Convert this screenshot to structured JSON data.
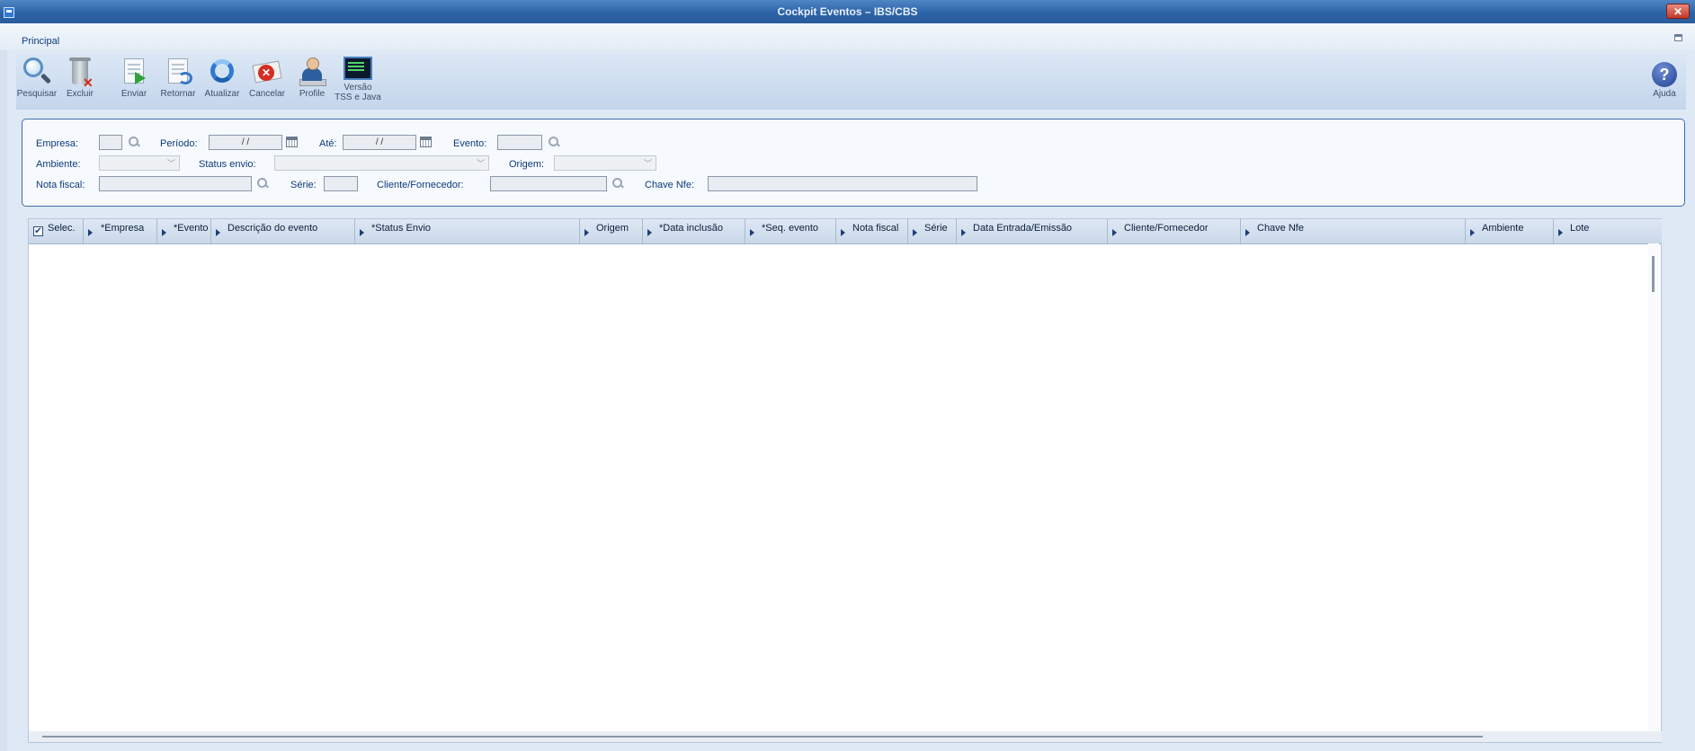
{
  "window": {
    "title": "Cockpit Eventos – IBS/CBS",
    "close_glyph": "✕"
  },
  "tabs": [
    {
      "label": "Principal"
    }
  ],
  "toolbar": {
    "buttons": [
      {
        "label": "Pesquisar",
        "icon": "search-icon"
      },
      {
        "label": "Excluir",
        "icon": "trash-icon"
      },
      {
        "label": "Enviar",
        "icon": "send-document-icon"
      },
      {
        "label": "Retornar",
        "icon": "return-document-icon"
      },
      {
        "label": "Atualizar",
        "icon": "refresh-icon"
      },
      {
        "label": "Cancelar",
        "icon": "cancel-icon"
      },
      {
        "label": "Profile",
        "icon": "profile-icon"
      },
      {
        "label_line1": "Versão",
        "label_line2": "TSS e Java",
        "icon": "terminal-icon"
      }
    ],
    "help": {
      "label": "Ajuda",
      "glyph": "?",
      "icon": "help-icon"
    }
  },
  "filters": {
    "empresa": {
      "label": "Empresa:",
      "value": ""
    },
    "periodo": {
      "label": "Período:",
      "value": " / /"
    },
    "ate": {
      "label": "Até:",
      "value": " / /"
    },
    "evento": {
      "label": "Evento:",
      "value": ""
    },
    "ambiente": {
      "label": "Ambiente:",
      "value": ""
    },
    "status_envio": {
      "label": "Status envio:",
      "value": ""
    },
    "origem": {
      "label": "Origem:",
      "value": ""
    },
    "nota_fiscal": {
      "label": "Nota fiscal:",
      "value": ""
    },
    "serie": {
      "label": "Série:",
      "value": ""
    },
    "cliente_fornecedor": {
      "label": "Cliente/Fornecedor:",
      "value": ""
    },
    "chave_nfe": {
      "label": "Chave Nfe:",
      "value": ""
    }
  },
  "grid": {
    "select_all_checked": true,
    "columns": [
      "Selec.",
      "*Empresa",
      "*Evento",
      "Descrição do evento",
      "*Status Envio",
      "Origem",
      "*Data inclusão",
      "*Seq. evento",
      "Nota fiscal",
      "Série",
      "Data Entrada/Emissão",
      "Cliente/Fornecedor",
      "Chave Nfe",
      "Ambiente",
      "Lote"
    ],
    "rows": []
  },
  "colors": {
    "titlebar": "#2d63a7",
    "panel_border": "#3d6fa7",
    "label_text": "#0d3b7a"
  }
}
